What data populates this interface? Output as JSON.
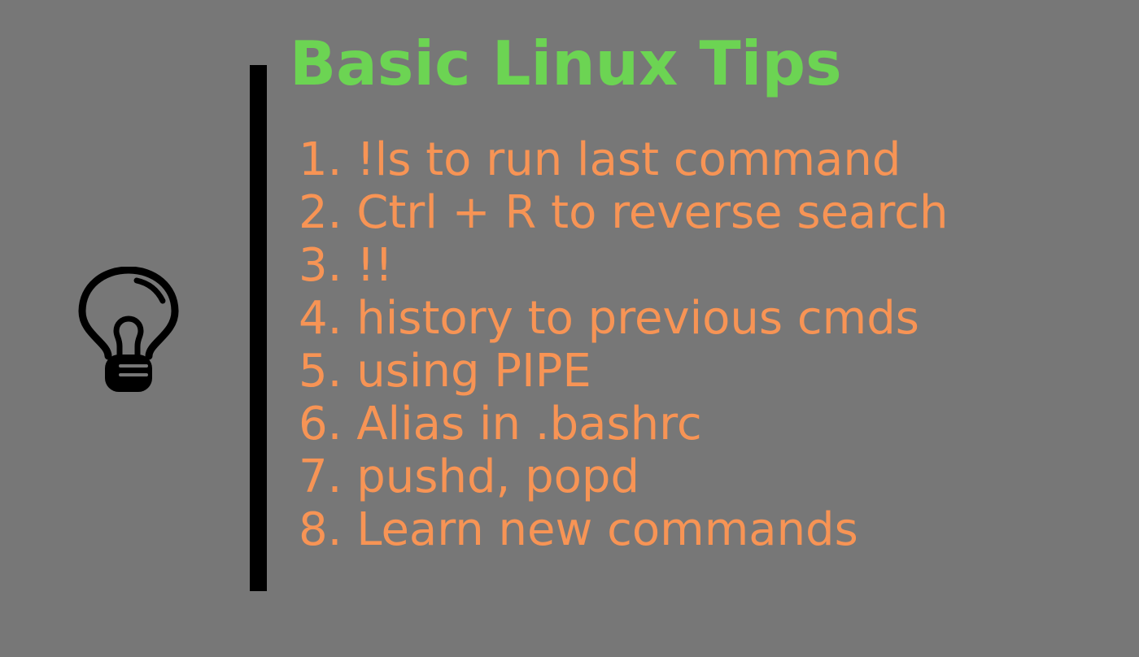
{
  "title": "Basic Linux Tips",
  "tips": [
    "1. !ls to run last command",
    "2. Ctrl + R to reverse search",
    "3. !!",
    "4. history to previous cmds",
    "5. using PIPE",
    "6. Alias in .bashrc",
    "7. pushd, popd",
    "8. Learn new commands"
  ],
  "icon": "lightbulb-icon",
  "colors": {
    "background": "#777777",
    "title": "#6CD453",
    "tips": "#F79455",
    "divider": "#000000",
    "icon": "#000000"
  }
}
